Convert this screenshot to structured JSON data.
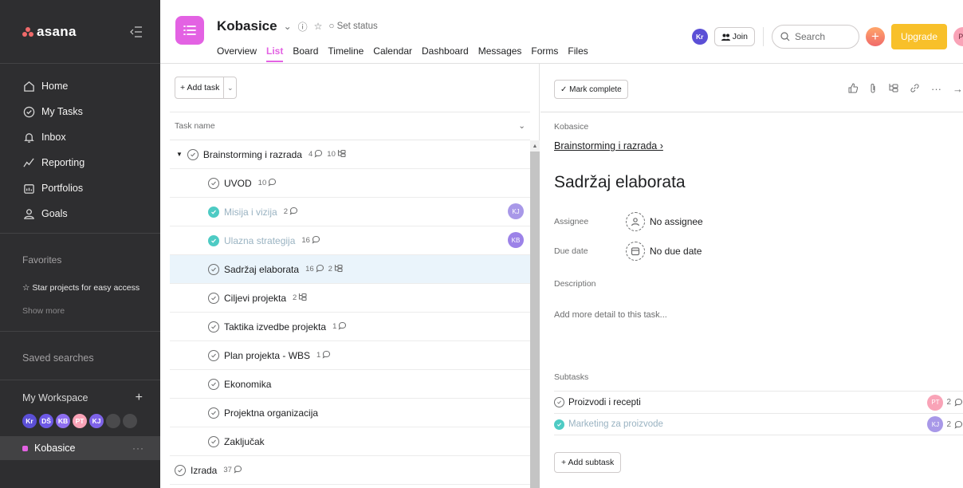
{
  "sidebar": {
    "logo": "asana",
    "collapse_icon": "sidebar-collapse-icon",
    "nav": [
      {
        "label": "Home",
        "icon": "home-icon"
      },
      {
        "label": "My Tasks",
        "icon": "check-circle-icon"
      },
      {
        "label": "Inbox",
        "icon": "bell-icon"
      },
      {
        "label": "Reporting",
        "icon": "chart-line-icon"
      },
      {
        "label": "Portfolios",
        "icon": "folder-icon"
      },
      {
        "label": "Goals",
        "icon": "person-icon"
      }
    ],
    "favorites_title": "Favorites",
    "favorites_star": "☆ Star projects for easy access",
    "show_more": "Show more",
    "saved_searches": "Saved searches",
    "workspace": "My Workspace",
    "workspace_add": "+",
    "members": [
      {
        "initials": "Kr",
        "color": "#5b4fd6"
      },
      {
        "initials": "DŠ",
        "color": "#6d59e6"
      },
      {
        "initials": "KB",
        "color": "#8d6ef0"
      },
      {
        "initials": "PT",
        "color": "#f9a3b7"
      },
      {
        "initials": "KJ",
        "color": "#7e63e8"
      },
      {
        "initials": "",
        "color": "#4a4a4c"
      },
      {
        "initials": "",
        "color": "#4a4a4c"
      }
    ],
    "project": "Kobasice",
    "project_more": "···"
  },
  "header": {
    "project_title": "Kobasice",
    "set_status": "○ Set status",
    "tabs": [
      "Overview",
      "List",
      "Board",
      "Timeline",
      "Calendar",
      "Dashboard",
      "Messages",
      "Forms",
      "Files"
    ],
    "active_tab": "List",
    "user_badge": "Kr",
    "join": "Join",
    "search": "Search",
    "upgrade": "Upgrade",
    "me": "PT",
    "accent": "#e362e3"
  },
  "list": {
    "add_task": "+ Add task",
    "column_task_name": "Task name",
    "rows": [
      {
        "name": "Brainstorming i razrada",
        "comments": "4",
        "subtasks": "10",
        "section": true
      },
      {
        "name": "UVOD",
        "comments": "10"
      },
      {
        "name": "Misija i vizija",
        "comments": "2",
        "done": true,
        "assignee": "KJ"
      },
      {
        "name": "Ulazna strategija",
        "comments": "16",
        "done": true,
        "assignee": "KB"
      },
      {
        "name": "Sadržaj elaborata",
        "comments": "16",
        "subtasks": "2",
        "selected": true
      },
      {
        "name": "Ciljevi projekta",
        "subtasks": "2"
      },
      {
        "name": "Taktika izvedbe projekta",
        "comments": "1"
      },
      {
        "name": "Plan projekta - WBS",
        "comments": "1"
      },
      {
        "name": "Ekonomika"
      },
      {
        "name": "Projektna organizacija"
      },
      {
        "name": "Zaključak"
      },
      {
        "name": "Izrada",
        "comments": "37",
        "top": true
      }
    ]
  },
  "detail": {
    "mark_complete": "✓ Mark complete",
    "project": "Kobasice",
    "parent": "Brainstorming i razrada ›",
    "title": "Sadržaj elaborata",
    "assignee_label": "Assignee",
    "assignee_value": "No assignee",
    "due_label": "Due date",
    "due_value": "No due date",
    "description_label": "Description",
    "description_placeholder": "Add more detail to this task...",
    "subtasks_label": "Subtasks",
    "subtasks": [
      {
        "name": "Proizvodi i recepti",
        "assignee": "PT",
        "av_color": "#f9a3b7",
        "comments": "2",
        "done": false
      },
      {
        "name": "Marketing za proizvode",
        "assignee": "KJ",
        "av_color": "#a898e8",
        "comments": "2",
        "done": true
      }
    ],
    "add_subtask": "+ Add subtask"
  }
}
